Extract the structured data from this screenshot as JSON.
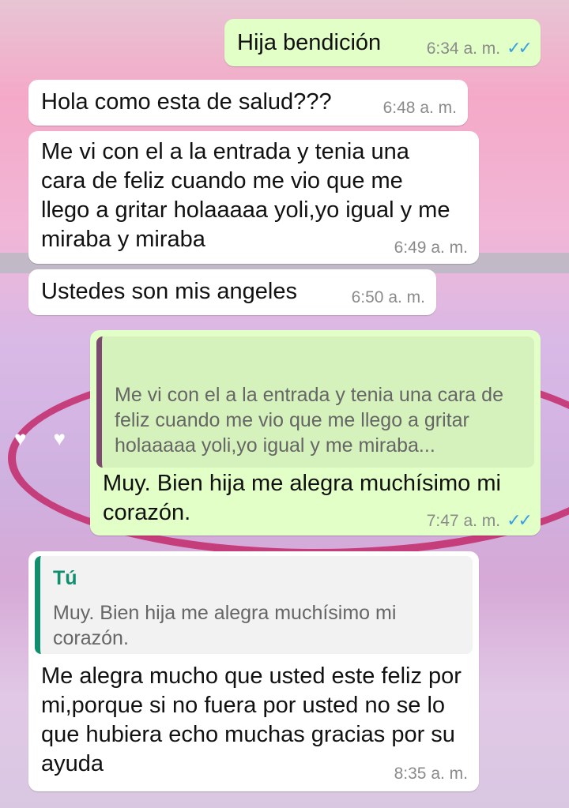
{
  "chat": {
    "messages": [
      {
        "id": 1,
        "direction": "outgoing",
        "text": "Hija  bendición",
        "time": "6:34 a. m.",
        "status": "read",
        "status_icon": "double-check-icon"
      },
      {
        "id": 2,
        "direction": "incoming",
        "text": "Hola como esta de salud???",
        "time": "6:48 a. m."
      },
      {
        "id": 3,
        "direction": "incoming",
        "text": "Me vi con el a la entrada y tenia una cara de feliz cuando me vio que me llego a gritar holaaaaa yoli,yo igual y me miraba y miraba",
        "time": "6:49 a. m."
      },
      {
        "id": 4,
        "direction": "incoming",
        "text": "Ustedes son mis angeles",
        "time": "6:50 a. m."
      },
      {
        "id": 5,
        "direction": "outgoing",
        "quote": {
          "text": "Me vi con el a la entrada y tenia una cara de feliz cuando me vio que me llego a gritar holaaaaa yoli,yo igual y me miraba..."
        },
        "text": "Muy. Bien hija me alegra muchísimo mi corazón.",
        "time": "7:47 a. m.",
        "status": "read",
        "status_icon": "double-check-icon"
      },
      {
        "id": 6,
        "direction": "incoming",
        "quote": {
          "author": "Tú",
          "text": "Muy. Bien hija me alegra muchísimo mi corazón."
        },
        "text": "Me alegra mucho que usted este feliz por mi,porque si no fuera por usted no se lo que hubiera echo muchas gracias por su ayuda",
        "time": "8:35 a. m."
      }
    ]
  },
  "colors": {
    "outgoing_bubble": "#e2ffc7",
    "incoming_bubble": "#ffffff",
    "read_tick": "#3aa0e0",
    "quote_bar_incoming_ref": "#7c4a6e",
    "quote_bar_self_ref": "#0f8f6e"
  }
}
